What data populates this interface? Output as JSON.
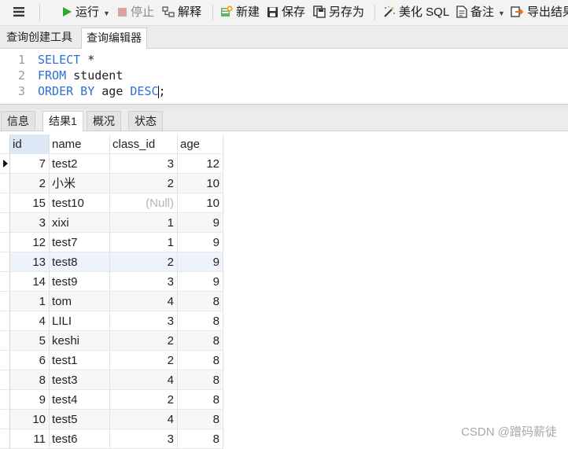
{
  "toolbar": {
    "run": "运行",
    "stop": "停止",
    "explain": "解释",
    "new": "新建",
    "save": "保存",
    "save_as": "另存为",
    "beautify": "美化 SQL",
    "note": "备注",
    "export": "导出结果"
  },
  "query_tabs": [
    "查询创建工具",
    "查询编辑器"
  ],
  "editor": {
    "lines": [
      {
        "num": "1",
        "kw": "SELECT",
        "rest": " *"
      },
      {
        "num": "2",
        "kw": "FROM",
        "rest": " student"
      },
      {
        "num": "3",
        "kw": "ORDER BY",
        "mid": " age ",
        "kw2": "DESC",
        "rest": ";"
      }
    ]
  },
  "result_tabs": [
    "信息",
    "结果1",
    "概况",
    "状态"
  ],
  "grid": {
    "columns": [
      "id",
      "name",
      "class_id",
      "age"
    ],
    "rows": [
      [
        "7",
        "test2",
        "3",
        "12"
      ],
      [
        "2",
        "小米",
        "2",
        "10"
      ],
      [
        "15",
        "test10",
        "(Null)",
        "10"
      ],
      [
        "3",
        "xixi",
        "1",
        "9"
      ],
      [
        "12",
        "test7",
        "1",
        "9"
      ],
      [
        "13",
        "test8",
        "2",
        "9"
      ],
      [
        "14",
        "test9",
        "3",
        "9"
      ],
      [
        "1",
        "tom",
        "4",
        "8"
      ],
      [
        "4",
        "LILI",
        "3",
        "8"
      ],
      [
        "5",
        "keshi",
        "2",
        "8"
      ],
      [
        "6",
        "test1",
        "2",
        "8"
      ],
      [
        "8",
        "test3",
        "4",
        "8"
      ],
      [
        "9",
        "test4",
        "2",
        "8"
      ],
      [
        "10",
        "test5",
        "4",
        "8"
      ],
      [
        "11",
        "test6",
        "3",
        "8"
      ]
    ]
  },
  "watermark": "CSDN @蹭码薪徒",
  "colors": {
    "keyword": "#2d6fd6",
    "run": "#2fa82f",
    "stop": "#d9a3a3"
  }
}
